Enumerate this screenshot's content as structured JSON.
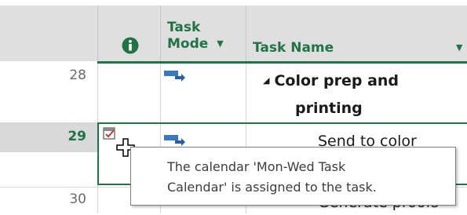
{
  "colors": {
    "accent": "#217346",
    "header_bg": "#dfdfdf",
    "rownum_bg_selected": "#d9d9d9",
    "info_icon": "#217346",
    "task_mode_icon": "#3a78c4"
  },
  "header": {
    "info_icon": "info-icon",
    "task_mode_line1": "Task",
    "task_mode_line2": "Mode",
    "task_name": "Task Name"
  },
  "rows": [
    {
      "id": "28",
      "name_line1": "Color prep and",
      "name_line2": "printing",
      "summary_marker": "◢"
    },
    {
      "id": "29",
      "name": "Send to color"
    },
    {
      "id": "30",
      "name": "Generate proofs"
    }
  ],
  "tooltip": {
    "line1": "The calendar 'Mon-Wed Task",
    "line2": "Calendar' is assigned to the task."
  }
}
